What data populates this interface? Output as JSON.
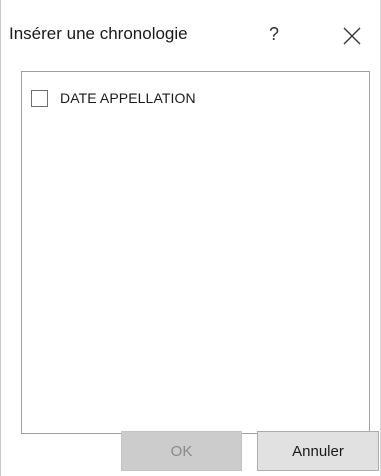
{
  "dialog": {
    "title": "Insérer une chronologie",
    "help_label": "?",
    "close_icon": "close-icon"
  },
  "fields": [
    {
      "label": "DATE APPELLATION",
      "checked": false
    }
  ],
  "buttons": {
    "ok_label": "OK",
    "ok_enabled": false,
    "cancel_label": "Annuler"
  }
}
